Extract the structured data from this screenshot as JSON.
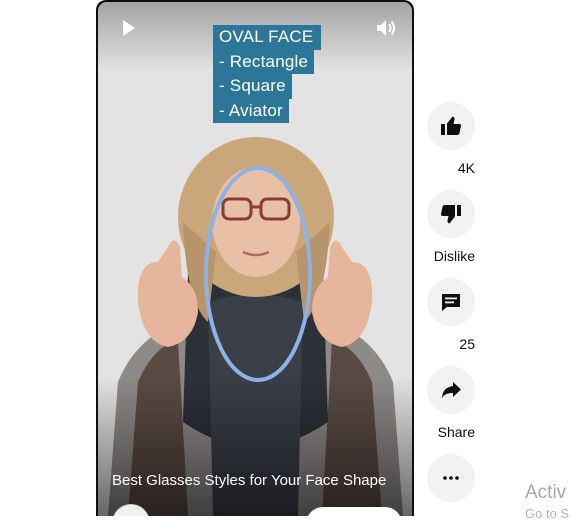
{
  "video": {
    "caption_lines": [
      "OVAL FACE",
      "- Rectangle",
      "- Square",
      "- Aviator"
    ],
    "title": "Best Glasses Styles for Your Face Shape",
    "controls": {
      "play_icon": "play-icon",
      "volume_icon": "volume-icon"
    }
  },
  "actions": {
    "like": {
      "label": "4K",
      "icon": "thumbs-up-icon"
    },
    "dislike": {
      "label": "Dislike",
      "icon": "thumbs-down-icon"
    },
    "comments": {
      "label": "25",
      "icon": "comment-icon"
    },
    "share": {
      "label": "Share",
      "icon": "share-icon"
    },
    "more": {
      "icon": "more-horizontal-icon"
    }
  },
  "watermark": {
    "title": "Activ",
    "subtitle": "Go to S"
  },
  "colors": {
    "caption_bg": "#2c7697",
    "action_bg": "#f2f2f2",
    "ellipse": "#8fb2e6"
  }
}
